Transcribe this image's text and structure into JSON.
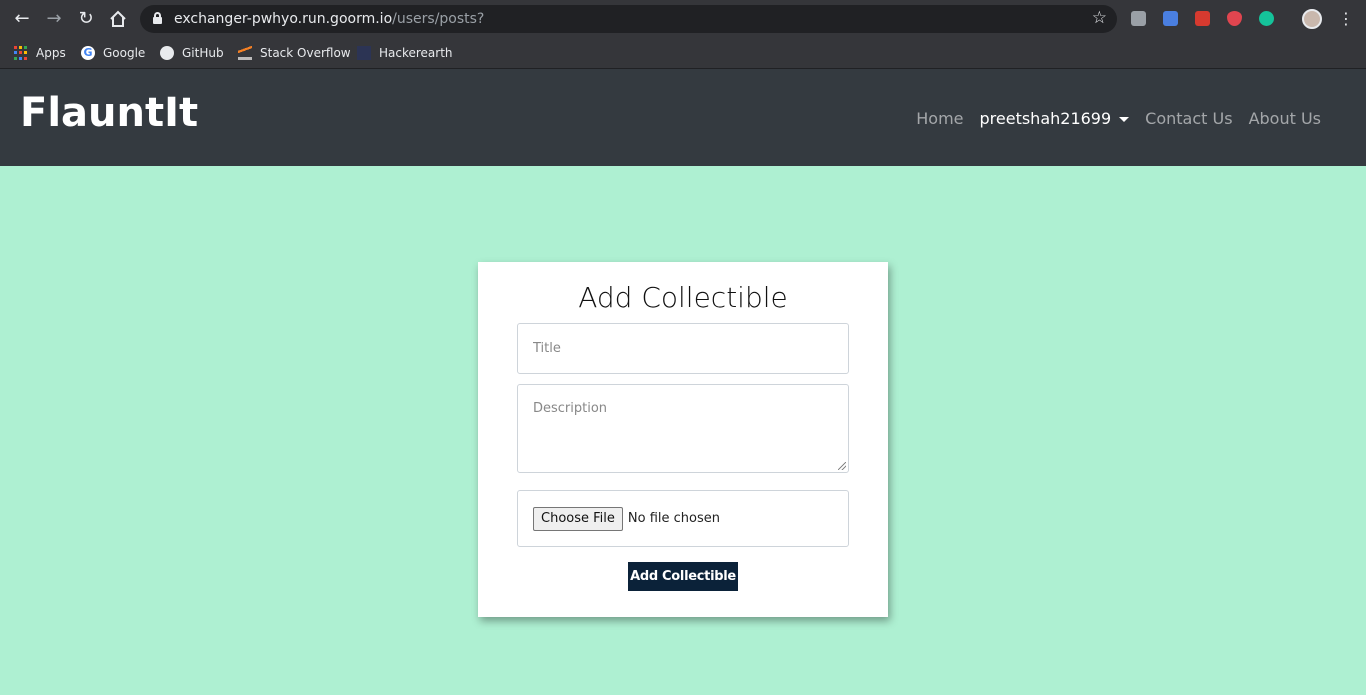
{
  "browser": {
    "url_host": "exchanger-pwhyo.run.goorm.io",
    "url_path": "/users/posts?",
    "bookmarks": [
      {
        "label": "Apps"
      },
      {
        "label": "Google"
      },
      {
        "label": "GitHub"
      },
      {
        "label": "Stack Overflow"
      },
      {
        "label": "Hackerearth"
      }
    ]
  },
  "navbar": {
    "brand": "FlauntIt",
    "links": {
      "home": "Home",
      "user": "preetshah21699",
      "contact": "Contact Us",
      "about": "About Us"
    }
  },
  "form": {
    "heading": "Add Collectible",
    "title_placeholder": "Title",
    "description_placeholder": "Description",
    "file_button": "Choose File",
    "file_status": "No file chosen",
    "submit_label": "Add Collectible"
  },
  "colors": {
    "page_background": "#aef0d2",
    "navbar_background": "#343a40",
    "submit_background": "#0b2239"
  }
}
